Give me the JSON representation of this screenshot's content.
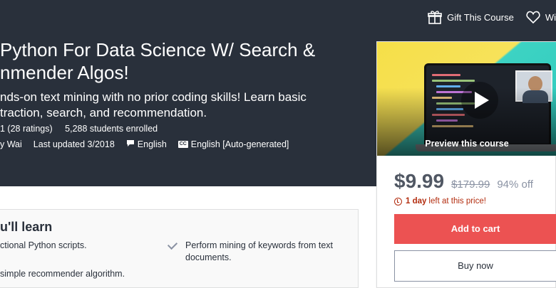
{
  "header": {
    "gift_label": "Gift This Course",
    "wishlist_label": "Wi"
  },
  "course": {
    "title_line1": "Python For Data Science W/ Search &",
    "title_line2": "nmender Algos!",
    "headline_line1": "nds-on text mining with no prior coding skills! Learn basic",
    "headline_line2": "traction, search, and recommendation.",
    "rating": "1 (28 ratings)",
    "students": "5,288 students enrolled",
    "author": "y Wai",
    "last_updated": "Last updated 3/2018",
    "language": "English",
    "captions": "English [Auto-generated]"
  },
  "preview": {
    "label": "Preview this course"
  },
  "pricing": {
    "price": "$9.99",
    "original_price": "$179.99",
    "discount": "94% off",
    "timer_bold": "1 day",
    "timer_rest": "left at this price!",
    "add_to_cart": "Add to cart",
    "buy_now": "Buy now"
  },
  "learn": {
    "title": "u'll learn",
    "items": [
      "ctional Python scripts.",
      "Perform mining of keywords from text",
      "documents.",
      "simple recommender algorithm."
    ]
  },
  "colors": {
    "hero_bg": "#29303b",
    "cart_button": "#ec5252",
    "price_text": "#505763",
    "timer_text": "#b32d0f"
  },
  "icons": {
    "gift": "gift-icon",
    "wishlist": "heart-icon",
    "language": "speech-bubble-icon",
    "captions": "closed-captions-icon",
    "timer": "alarm-clock-icon",
    "check": "checkmark-icon",
    "play": "play-icon"
  }
}
